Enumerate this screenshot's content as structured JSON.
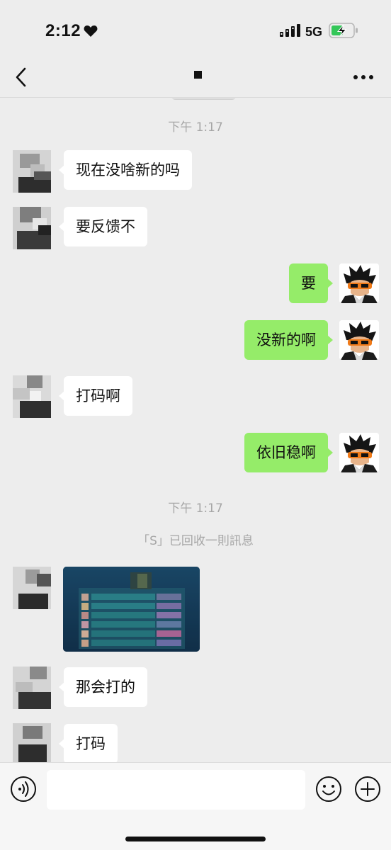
{
  "status_bar": {
    "time": "2:12",
    "network": "5G"
  },
  "nav": {
    "title": ""
  },
  "messages": [
    {
      "type": "time",
      "text": "下午 1:17"
    },
    {
      "type": "in",
      "text": "现在没啥新的吗"
    },
    {
      "type": "in",
      "text": "要反馈不"
    },
    {
      "type": "out",
      "text": "要"
    },
    {
      "type": "out",
      "text": "没新的啊"
    },
    {
      "type": "in",
      "text": "打码啊"
    },
    {
      "type": "out",
      "text": "依旧稳啊"
    },
    {
      "type": "time",
      "text": "下午 1:17"
    },
    {
      "type": "system",
      "text": "「S」已回收一則訊息"
    },
    {
      "type": "in_image",
      "text": ""
    },
    {
      "type": "in",
      "text": "那会打的"
    },
    {
      "type": "in",
      "text": "打码"
    }
  ],
  "input": {
    "value": "",
    "placeholder": ""
  },
  "colors": {
    "background": "#ededed",
    "bubble_out": "#95ec69",
    "bubble_in": "#ffffff",
    "battery_green": "#34c759"
  },
  "icons": {
    "back": "chevron-left-icon",
    "more": "more-dots-icon",
    "voice": "voice-icon",
    "emoji": "emoji-icon",
    "plus": "plus-icon"
  }
}
